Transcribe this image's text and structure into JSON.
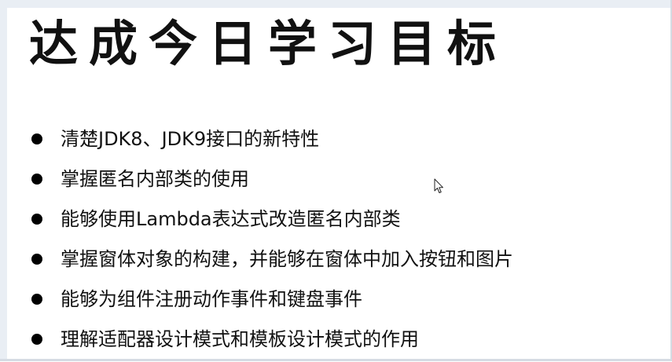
{
  "slide": {
    "title": "达成今日学习目标",
    "bullets": [
      {
        "text": "清楚JDK8、JDK9接口的新特性"
      },
      {
        "text": "掌握匿名内部类的使用"
      },
      {
        "text": "能够使用Lambda表达式改造匿名内部类"
      },
      {
        "text": "掌握窗体对象的构建，并能够在窗体中加入按钮和图片"
      },
      {
        "text": "能够为组件注册动作事件和键盘事件"
      },
      {
        "text": "理解适配器设计模式和模板设计模式的作用"
      }
    ]
  },
  "cursor": {
    "icon": "arrow-pointer-icon"
  }
}
